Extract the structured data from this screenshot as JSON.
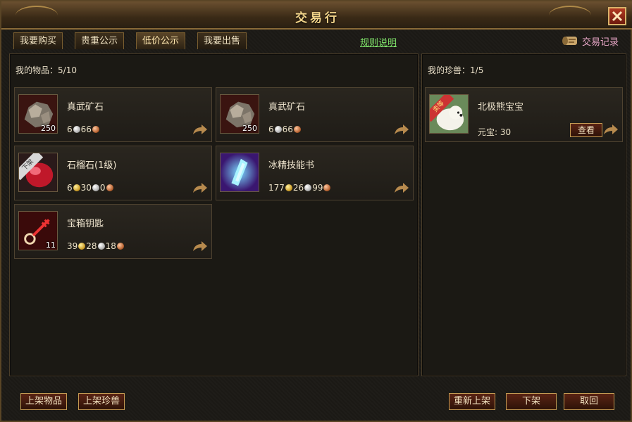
{
  "window": {
    "title": "交易行"
  },
  "tabs": [
    {
      "label": "我要购买"
    },
    {
      "label": "贵重公示"
    },
    {
      "label": "低价公示"
    },
    {
      "label": "我要出售"
    }
  ],
  "rules_link": "规则说明",
  "records_label": "交易记录",
  "items_panel": {
    "header_label": "我的物品：",
    "count": "5/10",
    "items": [
      {
        "name": "真武矿石",
        "qty": "250",
        "price": [
          "6",
          "66"
        ],
        "coins": [
          "silver",
          "copper"
        ],
        "icon": "ore-icon"
      },
      {
        "name": "真武矿石",
        "qty": "250",
        "price": [
          "6",
          "66"
        ],
        "coins": [
          "silver",
          "copper"
        ],
        "icon": "ore-icon"
      },
      {
        "name": "石榴石(1级)",
        "qty": "",
        "ribbon": "下架",
        "price": [
          "6",
          "30",
          "0"
        ],
        "coins": [
          "gold",
          "silver",
          "copper"
        ],
        "icon": "garnet-icon"
      },
      {
        "name": "冰精技能书",
        "qty": "",
        "price": [
          "177",
          "26",
          "99"
        ],
        "coins": [
          "gold",
          "silver",
          "copper"
        ],
        "icon": "crystal-icon"
      },
      {
        "name": "宝箱钥匙",
        "qty": "11",
        "price": [
          "39",
          "28",
          "18"
        ],
        "coins": [
          "gold",
          "silver",
          "copper"
        ],
        "icon": "key-icon"
      }
    ]
  },
  "pets_panel": {
    "header_label": "我的珍兽：",
    "count": "1/5",
    "pets": [
      {
        "name": "北极熊宝宝",
        "ribbon": "卖等",
        "yuanbao_label": "元宝:",
        "yuanbao_value": "30",
        "view_label": "查看",
        "icon": "polar-bear-icon"
      }
    ]
  },
  "buttons": {
    "list_item": "上架物品",
    "list_pet": "上架珍兽",
    "relist": "重新上架",
    "delist": "下架",
    "cancel": "取回"
  },
  "colors": {
    "rules_link": "#7fe36a",
    "records": "#e9a7c8",
    "title": "#f2d48a"
  }
}
